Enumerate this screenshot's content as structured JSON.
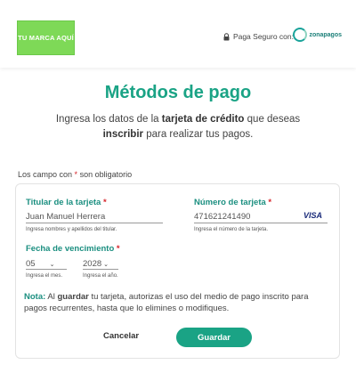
{
  "header": {
    "brand_logo_text": "TU MARCA AQUÍ",
    "secure_label": "Paga Seguro con:",
    "provider_logo_text": "zonapagos"
  },
  "page": {
    "title": "Métodos de pago",
    "subtitle_parts": [
      "Ingresa los datos de la ",
      "tarjeta de crédito",
      " que deseas ",
      "inscribir",
      " para realizar tus pagos."
    ]
  },
  "required_note": {
    "prefix": "Los campo con ",
    "star": "*",
    "suffix": " son obligatorio"
  },
  "form": {
    "holder": {
      "label": "Titular de la tarjeta ",
      "star": "*",
      "value": "Juan Manuel Herrera",
      "help": "Ingresa nombres y apellidos del titular."
    },
    "card_number": {
      "label": "Número de tarjeta ",
      "star": "*",
      "value": "471621241490",
      "brand": "VISA",
      "help": "Ingresa el número de la tarjeta."
    },
    "expiry": {
      "label": "Fecha de vencimiento ",
      "star": "*",
      "month": {
        "value": "05",
        "help": "Ingresa el mes."
      },
      "year": {
        "value": "2028",
        "help": "Ingresa el año."
      }
    },
    "note": {
      "label": "Nota:",
      "t1": " Al ",
      "bold": "guardar",
      "t2": " tu tarjeta, autorizas el uso del medio de pago inscrito para pagos recurrentes, hasta que lo elimines o modifiques."
    },
    "cancel_label": "Cancelar",
    "save_label": "Guardar"
  },
  "colors": {
    "accent": "#1aa385",
    "brand_logo": "#7ed957",
    "required": "#d6262b",
    "visa": "#1a2b7a"
  }
}
